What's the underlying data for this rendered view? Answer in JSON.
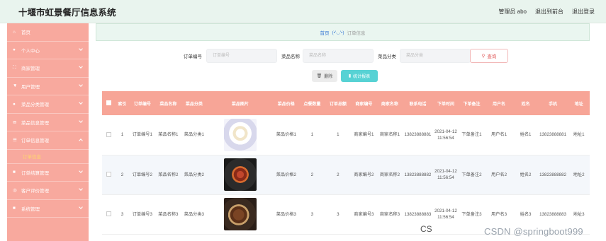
{
  "header": {
    "title": "十堰市虹景餐厅信息系统",
    "admin_label": "管理员 abo",
    "back_label": "退出到前台",
    "logout_label": "退出登录"
  },
  "sidebar": {
    "items": [
      {
        "icon": "home-icon",
        "glyph": "⌂",
        "label": "首页"
      },
      {
        "icon": "user-icon",
        "glyph": "●",
        "label": "个人中心"
      },
      {
        "icon": "shop-icon",
        "glyph": "⛶",
        "label": "商家管理"
      },
      {
        "icon": "users-icon",
        "glyph": "▼",
        "label": "用户管理"
      },
      {
        "icon": "category-icon",
        "glyph": "●",
        "label": "菜品分类管理"
      },
      {
        "icon": "mail-icon",
        "glyph": "✉",
        "label": "菜品信息管理"
      },
      {
        "icon": "list-icon",
        "glyph": "☰",
        "label": "订单信息管理"
      },
      {
        "icon": "settle-icon",
        "glyph": "■",
        "label": "订单结算管理"
      },
      {
        "icon": "review-icon",
        "glyph": "◎",
        "label": "客户评价管理"
      },
      {
        "icon": "system-icon",
        "glyph": "■",
        "label": "系统管理"
      }
    ],
    "active_sub": "订单信息"
  },
  "breadcrumb": {
    "home": "首页",
    "sep": "(•'◡'•)",
    "current": "订单信息"
  },
  "search": {
    "order_no_label": "订单编号",
    "order_no_placeholder": "订单编号",
    "dish_name_label": "菜品名称",
    "dish_name_placeholder": "菜品名称",
    "category_label": "菜品分类",
    "category_placeholder": "菜品分类",
    "search_label": "查询"
  },
  "actions": {
    "delete_label": "删除",
    "stats_label": "统计报表"
  },
  "table": {
    "headers": [
      "索引",
      "订单编号",
      "菜品名称",
      "菜品分类",
      "菜品图片",
      "菜品价格",
      "点餐数量",
      "订单总额",
      "商家编号",
      "商家名称",
      "联系电话",
      "下单时间",
      "下单备注",
      "用户名",
      "姓名",
      "手机",
      "地址"
    ],
    "rows": [
      {
        "index": "1",
        "order_no": "订单编号1",
        "dish_name": "菜品名称1",
        "category": "菜品分类1",
        "price": "菜品价格1",
        "qty": "1",
        "total": "1",
        "shop_no": "商家编号1",
        "shop_name": "商家名称1",
        "phone": "13823888881",
        "time": "2021-04-12 11:56:54",
        "note": "下单备注1",
        "username": "用户名1",
        "name": "姓名1",
        "mobile": "13823888881",
        "address": "地址1"
      },
      {
        "index": "2",
        "order_no": "订单编号2",
        "dish_name": "菜品名称2",
        "category": "菜品分类2",
        "price": "菜品价格2",
        "qty": "2",
        "total": "2",
        "shop_no": "商家编号2",
        "shop_name": "商家名称2",
        "phone": "13823888882",
        "time": "2021-04-12 11:56:54",
        "note": "下单备注2",
        "username": "用户名2",
        "name": "姓名2",
        "mobile": "13823888882",
        "address": "地址2"
      },
      {
        "index": "3",
        "order_no": "订单编号3",
        "dish_name": "菜品名称3",
        "category": "菜品分类3",
        "price": "菜品价格3",
        "qty": "3",
        "total": "3",
        "shop_no": "商家编号3",
        "shop_name": "商家名称3",
        "phone": "13823888883",
        "time": "2021-04-12 11:56:54",
        "note": "下单备注3",
        "username": "用户名3",
        "name": "姓名3",
        "mobile": "13823888883",
        "address": "地址3"
      }
    ]
  },
  "overlay": {
    "cs_text": "CS",
    "watermark": "CSDN @springboot999"
  }
}
